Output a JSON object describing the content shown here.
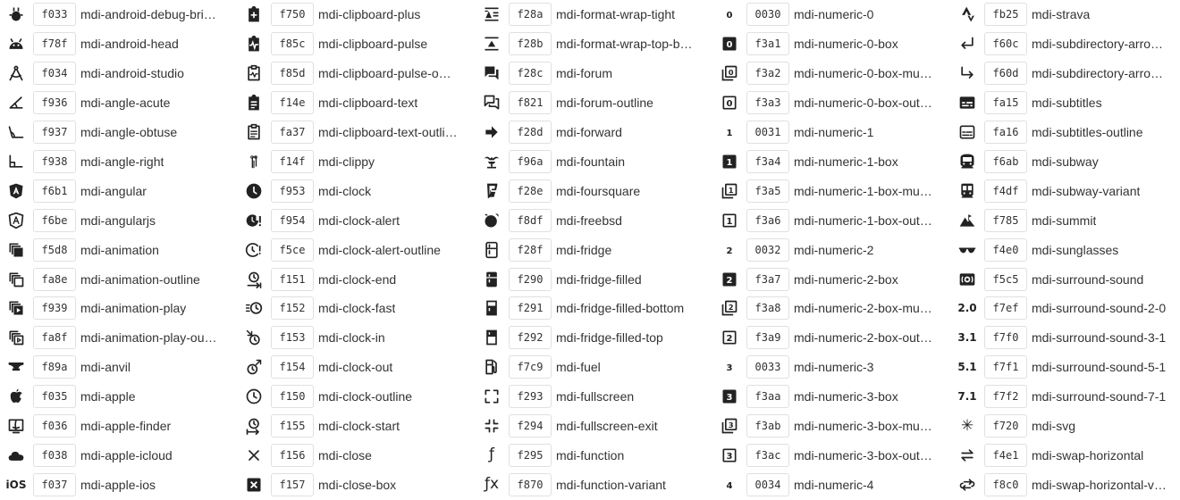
{
  "columns": [
    {
      "items": [
        {
          "code": "f033",
          "name": "mdi-android-debug-bri…",
          "icon": "android-debug-bridge-icon",
          "glyph": "bug"
        },
        {
          "code": "f78f",
          "name": "mdi-android-head",
          "icon": "android-head-icon",
          "glyph": "android"
        },
        {
          "code": "f034",
          "name": "mdi-android-studio",
          "icon": "android-studio-icon",
          "glyph": "compass"
        },
        {
          "code": "f936",
          "name": "mdi-angle-acute",
          "icon": "angle-acute-icon",
          "glyph": "acute"
        },
        {
          "code": "f937",
          "name": "mdi-angle-obtuse",
          "icon": "angle-obtuse-icon",
          "glyph": "obtuse"
        },
        {
          "code": "f938",
          "name": "mdi-angle-right",
          "icon": "angle-right-icon",
          "glyph": "right"
        },
        {
          "code": "f6b1",
          "name": "mdi-angular",
          "icon": "angular-icon",
          "glyph": "shieldA"
        },
        {
          "code": "f6be",
          "name": "mdi-angularjs",
          "icon": "angularjs-icon",
          "glyph": "shieldAo"
        },
        {
          "code": "f5d8",
          "name": "mdi-animation",
          "icon": "animation-icon",
          "glyph": "stack"
        },
        {
          "code": "fa8e",
          "name": "mdi-animation-outline",
          "icon": "animation-outline-icon",
          "glyph": "stacko"
        },
        {
          "code": "f939",
          "name": "mdi-animation-play",
          "icon": "animation-play-icon",
          "glyph": "stackplay"
        },
        {
          "code": "fa8f",
          "name": "mdi-animation-play-ou…",
          "icon": "animation-play-outline-icon",
          "glyph": "stackplayo"
        },
        {
          "code": "f89a",
          "name": "mdi-anvil",
          "icon": "anvil-icon",
          "glyph": "anvil"
        },
        {
          "code": "f035",
          "name": "mdi-apple",
          "icon": "apple-icon",
          "glyph": "apple"
        },
        {
          "code": "f036",
          "name": "mdi-apple-finder",
          "icon": "apple-finder-icon",
          "glyph": "finder"
        },
        {
          "code": "f038",
          "name": "mdi-apple-icloud",
          "icon": "apple-icloud-icon",
          "glyph": "cloud"
        },
        {
          "code": "f037",
          "name": "mdi-apple-ios",
          "icon": "apple-ios-icon",
          "text": "iOS"
        }
      ]
    },
    {
      "items": [
        {
          "code": "f750",
          "name": "mdi-clipboard-plus",
          "icon": "clipboard-plus-icon",
          "glyph": "clipplus"
        },
        {
          "code": "f85c",
          "name": "mdi-clipboard-pulse",
          "icon": "clipboard-pulse-icon",
          "glyph": "clippulse"
        },
        {
          "code": "f85d",
          "name": "mdi-clipboard-pulse-o…",
          "icon": "clipboard-pulse-outline-icon",
          "glyph": "clippulseo"
        },
        {
          "code": "f14e",
          "name": "mdi-clipboard-text",
          "icon": "clipboard-text-icon",
          "glyph": "cliptext"
        },
        {
          "code": "fa37",
          "name": "mdi-clipboard-text-outli…",
          "icon": "clipboard-text-outline-icon",
          "glyph": "cliptexto"
        },
        {
          "code": "f14f",
          "name": "mdi-clippy",
          "icon": "clippy-icon",
          "glyph": "clippy"
        },
        {
          "code": "f953",
          "name": "mdi-clock",
          "icon": "clock-icon",
          "glyph": "clockfill"
        },
        {
          "code": "f954",
          "name": "mdi-clock-alert",
          "icon": "clock-alert-icon",
          "glyph": "clockalert"
        },
        {
          "code": "f5ce",
          "name": "mdi-clock-alert-outline",
          "icon": "clock-alert-outline-icon",
          "glyph": "clockalerto"
        },
        {
          "code": "f151",
          "name": "mdi-clock-end",
          "icon": "clock-end-icon",
          "glyph": "clockend"
        },
        {
          "code": "f152",
          "name": "mdi-clock-fast",
          "icon": "clock-fast-icon",
          "glyph": "clockfast"
        },
        {
          "code": "f153",
          "name": "mdi-clock-in",
          "icon": "clock-in-icon",
          "glyph": "clockin"
        },
        {
          "code": "f154",
          "name": "mdi-clock-out",
          "icon": "clock-out-icon",
          "glyph": "clockout"
        },
        {
          "code": "f150",
          "name": "mdi-clock-outline",
          "icon": "clock-outline-icon",
          "glyph": "clocko"
        },
        {
          "code": "f155",
          "name": "mdi-clock-start",
          "icon": "clock-start-icon",
          "glyph": "clockstart"
        },
        {
          "code": "f156",
          "name": "mdi-close",
          "icon": "close-icon",
          "glyph": "close"
        },
        {
          "code": "f157",
          "name": "mdi-close-box",
          "icon": "close-box-icon",
          "glyph": "closebox"
        }
      ]
    },
    {
      "items": [
        {
          "code": "f28a",
          "name": "mdi-format-wrap-tight",
          "icon": "format-wrap-tight-icon",
          "glyph": "wraptight"
        },
        {
          "code": "f28b",
          "name": "mdi-format-wrap-top-b…",
          "icon": "format-wrap-top-bottom-icon",
          "glyph": "wraptop"
        },
        {
          "code": "f28c",
          "name": "mdi-forum",
          "icon": "forum-icon",
          "glyph": "forum"
        },
        {
          "code": "f821",
          "name": "mdi-forum-outline",
          "icon": "forum-outline-icon",
          "glyph": "forumo"
        },
        {
          "code": "f28d",
          "name": "mdi-forward",
          "icon": "forward-icon",
          "glyph": "forward"
        },
        {
          "code": "f96a",
          "name": "mdi-fountain",
          "icon": "fountain-icon",
          "glyph": "fountain"
        },
        {
          "code": "f28e",
          "name": "mdi-foursquare",
          "icon": "foursquare-icon",
          "glyph": "foursquare"
        },
        {
          "code": "f8df",
          "name": "mdi-freebsd",
          "icon": "freebsd-icon",
          "glyph": "freebsd"
        },
        {
          "code": "f28f",
          "name": "mdi-fridge",
          "icon": "fridge-icon",
          "glyph": "fridge"
        },
        {
          "code": "f290",
          "name": "mdi-fridge-filled",
          "icon": "fridge-filled-icon",
          "glyph": "fridgefill"
        },
        {
          "code": "f291",
          "name": "mdi-fridge-filled-bottom",
          "icon": "fridge-filled-bottom-icon",
          "glyph": "fridgebottom"
        },
        {
          "code": "f292",
          "name": "mdi-fridge-filled-top",
          "icon": "fridge-filled-top-icon",
          "glyph": "fridgetop"
        },
        {
          "code": "f7c9",
          "name": "mdi-fuel",
          "icon": "fuel-icon",
          "glyph": "fuel"
        },
        {
          "code": "f293",
          "name": "mdi-fullscreen",
          "icon": "fullscreen-icon",
          "glyph": "fullscreen"
        },
        {
          "code": "f294",
          "name": "mdi-fullscreen-exit",
          "icon": "fullscreen-exit-icon",
          "glyph": "fullscreenexit"
        },
        {
          "code": "f295",
          "name": "mdi-function",
          "icon": "function-icon",
          "unicode": "ƒ"
        },
        {
          "code": "f870",
          "name": "mdi-function-variant",
          "icon": "function-variant-icon",
          "unicode": "ƒx"
        }
      ]
    },
    {
      "items": [
        {
          "code": "0030",
          "name": "mdi-numeric-0",
          "icon": "numeric-0-icon",
          "num": "0",
          "style": "plain"
        },
        {
          "code": "f3a1",
          "name": "mdi-numeric-0-box",
          "icon": "numeric-0-box-icon",
          "num": "0",
          "style": "box"
        },
        {
          "code": "f3a2",
          "name": "mdi-numeric-0-box-mu…",
          "icon": "numeric-0-box-multiple-icon",
          "num": "0",
          "style": "multi"
        },
        {
          "code": "f3a3",
          "name": "mdi-numeric-0-box-out…",
          "icon": "numeric-0-box-outline-icon",
          "num": "0",
          "style": "outline"
        },
        {
          "code": "0031",
          "name": "mdi-numeric-1",
          "icon": "numeric-1-icon",
          "num": "1",
          "style": "plain"
        },
        {
          "code": "f3a4",
          "name": "mdi-numeric-1-box",
          "icon": "numeric-1-box-icon",
          "num": "1",
          "style": "box"
        },
        {
          "code": "f3a5",
          "name": "mdi-numeric-1-box-mu…",
          "icon": "numeric-1-box-multiple-icon",
          "num": "1",
          "style": "multi"
        },
        {
          "code": "f3a6",
          "name": "mdi-numeric-1-box-out…",
          "icon": "numeric-1-box-outline-icon",
          "num": "1",
          "style": "outline"
        },
        {
          "code": "0032",
          "name": "mdi-numeric-2",
          "icon": "numeric-2-icon",
          "num": "2",
          "style": "plain"
        },
        {
          "code": "f3a7",
          "name": "mdi-numeric-2-box",
          "icon": "numeric-2-box-icon",
          "num": "2",
          "style": "box"
        },
        {
          "code": "f3a8",
          "name": "mdi-numeric-2-box-mu…",
          "icon": "numeric-2-box-multiple-icon",
          "num": "2",
          "style": "multi"
        },
        {
          "code": "f3a9",
          "name": "mdi-numeric-2-box-out…",
          "icon": "numeric-2-box-outline-icon",
          "num": "2",
          "style": "outline"
        },
        {
          "code": "0033",
          "name": "mdi-numeric-3",
          "icon": "numeric-3-icon",
          "num": "3",
          "style": "plain"
        },
        {
          "code": "f3aa",
          "name": "mdi-numeric-3-box",
          "icon": "numeric-3-box-icon",
          "num": "3",
          "style": "box"
        },
        {
          "code": "f3ab",
          "name": "mdi-numeric-3-box-mu…",
          "icon": "numeric-3-box-multiple-icon",
          "num": "3",
          "style": "multi"
        },
        {
          "code": "f3ac",
          "name": "mdi-numeric-3-box-out…",
          "icon": "numeric-3-box-outline-icon",
          "num": "3",
          "style": "outline"
        },
        {
          "code": "0034",
          "name": "mdi-numeric-4",
          "icon": "numeric-4-icon",
          "num": "4",
          "style": "plain"
        }
      ]
    },
    {
      "items": [
        {
          "code": "fb25",
          "name": "mdi-strava",
          "icon": "strava-icon",
          "glyph": "strava"
        },
        {
          "code": "f60c",
          "name": "mdi-subdirectory-arro…",
          "icon": "subdirectory-arrow-left-icon",
          "glyph": "subleft"
        },
        {
          "code": "f60d",
          "name": "mdi-subdirectory-arro…",
          "icon": "subdirectory-arrow-right-icon",
          "glyph": "subright"
        },
        {
          "code": "fa15",
          "name": "mdi-subtitles",
          "icon": "subtitles-icon",
          "glyph": "subtitles"
        },
        {
          "code": "fa16",
          "name": "mdi-subtitles-outline",
          "icon": "subtitles-outline-icon",
          "glyph": "subtitleso"
        },
        {
          "code": "f6ab",
          "name": "mdi-subway",
          "icon": "subway-icon",
          "glyph": "subway"
        },
        {
          "code": "f4df",
          "name": "mdi-subway-variant",
          "icon": "subway-variant-icon",
          "glyph": "subwayv"
        },
        {
          "code": "f785",
          "name": "mdi-summit",
          "icon": "summit-icon",
          "glyph": "summit"
        },
        {
          "code": "f4e0",
          "name": "mdi-sunglasses",
          "icon": "sunglasses-icon",
          "glyph": "sunglasses"
        },
        {
          "code": "f5c5",
          "name": "mdi-surround-sound",
          "icon": "surround-sound-icon",
          "glyph": "surround"
        },
        {
          "code": "f7ef",
          "name": "mdi-surround-sound-2-0",
          "icon": "surround-sound-2-0-icon",
          "text": "2.0"
        },
        {
          "code": "f7f0",
          "name": "mdi-surround-sound-3-1",
          "icon": "surround-sound-3-1-icon",
          "text": "3.1"
        },
        {
          "code": "f7f1",
          "name": "mdi-surround-sound-5-1",
          "icon": "surround-sound-5-1-icon",
          "text": "5.1"
        },
        {
          "code": "f7f2",
          "name": "mdi-surround-sound-7-1",
          "icon": "surround-sound-7-1-icon",
          "text": "7.1"
        },
        {
          "code": "f720",
          "name": "mdi-svg",
          "icon": "svg-icon",
          "unicode": "✳"
        },
        {
          "code": "f4e1",
          "name": "mdi-swap-horizontal",
          "icon": "swap-horizontal-icon",
          "glyph": "swaph"
        },
        {
          "code": "f8c0",
          "name": "mdi-swap-horizontal-v…",
          "icon": "swap-horizontal-variant-icon",
          "glyph": "swaphv"
        }
      ]
    }
  ]
}
